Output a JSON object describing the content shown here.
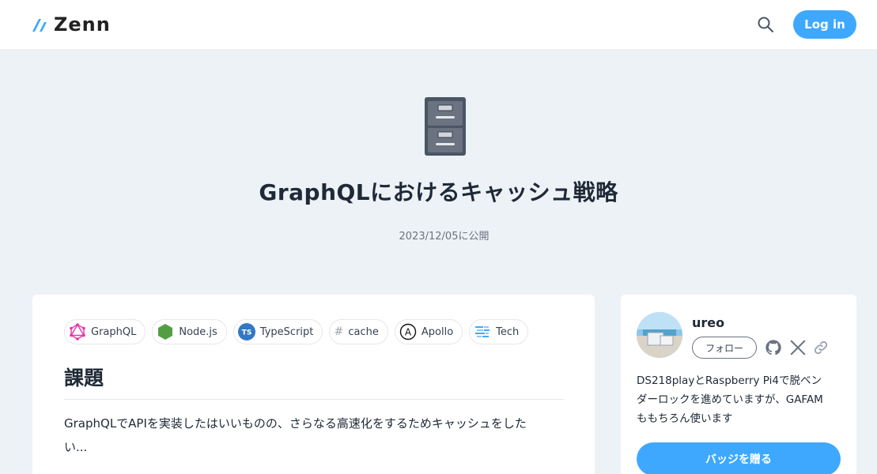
{
  "header": {
    "logo_text": "Zenn",
    "search_icon": "search-icon",
    "login_label": "Log in"
  },
  "hero": {
    "emoji": "file-cabinet",
    "title": "GraphQLにおけるキャッシュ戦略",
    "published": "2023/12/05に公開"
  },
  "topics": [
    {
      "label": "GraphQL",
      "icon": "graphql-icon"
    },
    {
      "label": "Node.js",
      "icon": "nodejs-icon"
    },
    {
      "label": "TypeScript",
      "icon": "typescript-icon"
    },
    {
      "label": "cache",
      "icon": "hash-icon"
    },
    {
      "label": "Apollo",
      "icon": "apollo-icon"
    },
    {
      "label": "Tech",
      "icon": "tech-icon"
    }
  ],
  "article": {
    "section_heading": "課題",
    "body_line1": "GraphQLでAPIを実装したはいいものの、さらなる高速化をするためキャッシュをした",
    "body_line2": "い..."
  },
  "author": {
    "name": "ureo",
    "follow_label": "フォロー",
    "bio_line1": "DS218playとRaspberry Pi4で脱ベン",
    "bio_line2": "ダーロックを進めていますが、GAFAM",
    "bio_line3": "ももちろん使います",
    "badge_label": "バッジを贈る",
    "social_icons": [
      "github-icon",
      "x-icon",
      "link-icon"
    ]
  },
  "colors": {
    "accent": "#3ea8ff",
    "page_bg": "#edf2f7"
  }
}
